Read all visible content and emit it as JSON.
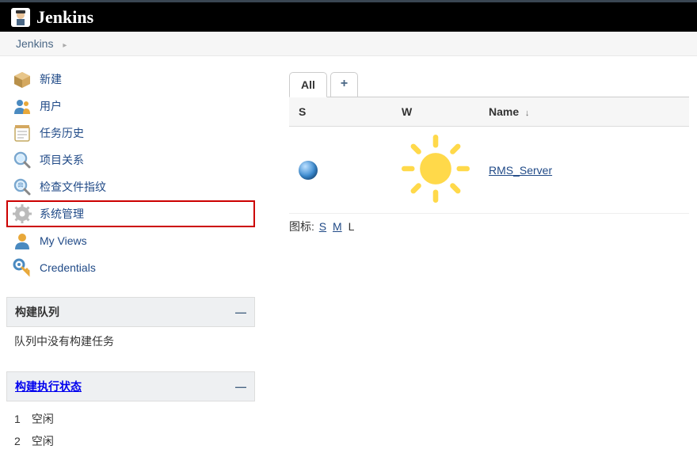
{
  "header": {
    "title": "Jenkins"
  },
  "breadcrumb": {
    "items": [
      "Jenkins"
    ]
  },
  "sidebar": {
    "items": [
      {
        "label": "新建"
      },
      {
        "label": "用户"
      },
      {
        "label": "任务历史"
      },
      {
        "label": "项目关系"
      },
      {
        "label": "检查文件指纹"
      },
      {
        "label": "系统管理"
      },
      {
        "label": "My Views"
      },
      {
        "label": "Credentials"
      }
    ]
  },
  "build_queue": {
    "title": "构建队列",
    "empty_text": "队列中没有构建任务"
  },
  "executor_status": {
    "title": "构建执行状态",
    "executors": [
      {
        "num": "1",
        "state": "空闲"
      },
      {
        "num": "2",
        "state": "空闲"
      }
    ]
  },
  "main": {
    "tabs": {
      "all": "All",
      "add": "+"
    },
    "columns": {
      "status": "S",
      "weather": "W",
      "name": "Name"
    },
    "jobs": [
      {
        "name": "RMS_Server"
      }
    ],
    "icon_legend": {
      "label": "图标:",
      "sizes": [
        "S",
        "M",
        "L"
      ],
      "current": "L"
    }
  }
}
